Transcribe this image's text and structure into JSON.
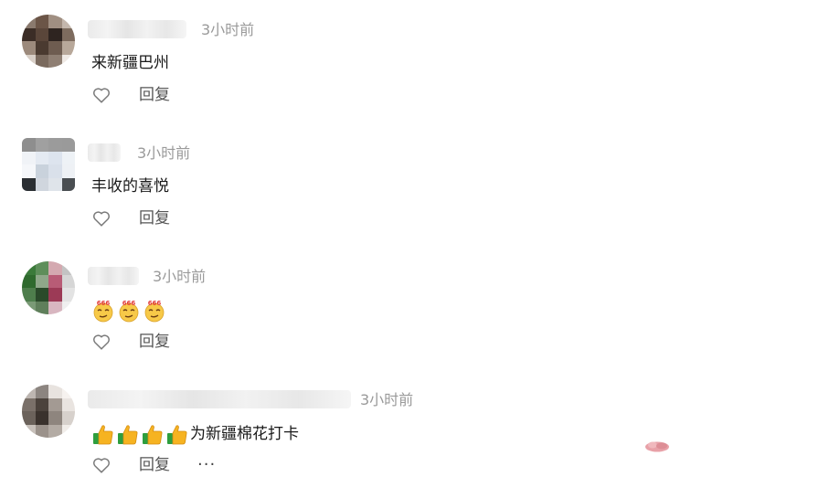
{
  "comments": [
    {
      "time": "3小时前",
      "text": "来新疆巴州",
      "reply_label": "回复",
      "avatar_colors": [
        "#8a7a6e",
        "#6b5547",
        "#a08f82",
        "#c4b7ad",
        "#3b2d26",
        "#5a463a",
        "#2e2420",
        "#7d6b5e",
        "#9c8a7c",
        "#4a3a30",
        "#6e5c50",
        "#b8a89a",
        "#d8cfc7",
        "#7a6a5e",
        "#8f7f73",
        "#efe9e4"
      ]
    },
    {
      "time": "3小时前",
      "text": "丰收的喜悦",
      "reply_label": "回复",
      "avatar_colors": [
        "#8e8e8e",
        "#a0a0a0",
        "#9b9b9b",
        "#9a9a9a",
        "#f0f3f7",
        "#e4eaf2",
        "#dde4ee",
        "#eef2f6",
        "#f5f7fa",
        "#c9d2dc",
        "#d9e0ea",
        "#eef1f5",
        "#2b2f33",
        "#d0d6de",
        "#dfe4ea",
        "#4a4e52"
      ]
    },
    {
      "time": "3小时前",
      "text": "",
      "emoji_count": 3,
      "emoji_name": "666-emoji",
      "reply_label": "回复",
      "avatar_colors": [
        "#3b7a3a",
        "#5e8e5a",
        "#d4a9b0",
        "#c3c3c3",
        "#2f6a2e",
        "#8fa88a",
        "#b85c76",
        "#d6d6d6",
        "#4e7e4c",
        "#2a4a2a",
        "#9c3a56",
        "#e3e3e3",
        "#7a9a76",
        "#5f7f5b",
        "#d8b6c0",
        "#efefef"
      ]
    },
    {
      "time": "3小时前",
      "text": "为新疆棉花打卡",
      "thumb_count": 4,
      "reply_label": "回复",
      "more_label": "···",
      "avatar_colors": [
        "#bdb6b1",
        "#8c8580",
        "#e8e3df",
        "#f6f2ef",
        "#7a7069",
        "#4b423c",
        "#a39a93",
        "#e9e4e0",
        "#6b625b",
        "#3a322d",
        "#8e857e",
        "#d7d1cc",
        "#c7c0ba",
        "#9b928b",
        "#b3aba4",
        "#f1ede9"
      ]
    }
  ],
  "colors": {
    "time_text": "#9a9a9a",
    "icon_stroke": "#7a7a7a"
  }
}
